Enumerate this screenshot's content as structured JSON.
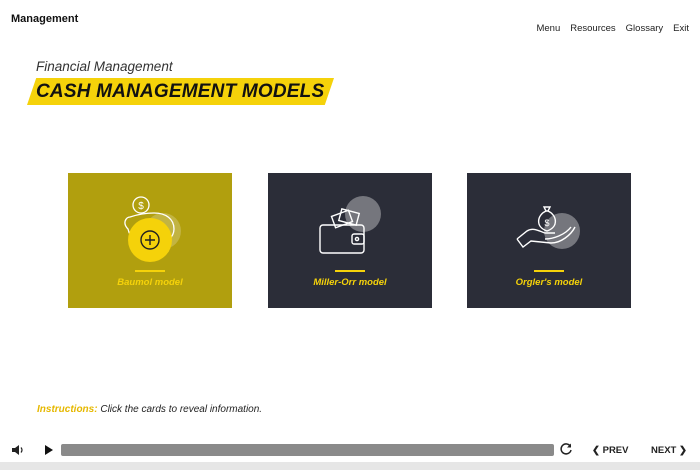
{
  "app": {
    "title": "Management"
  },
  "nav": {
    "menu": "Menu",
    "resources": "Resources",
    "glossary": "Glossary",
    "exit": "Exit"
  },
  "header": {
    "subtitle": "Financial Management",
    "title": "CASH MANAGEMENT MODELS"
  },
  "cards": [
    {
      "label": "Baumol model",
      "icon": "piggy-bank-coin-icon",
      "state": "hover"
    },
    {
      "label": "Miller-Orr model",
      "icon": "wallet-cash-icon"
    },
    {
      "label": "Orgler's model",
      "icon": "hand-money-bag-icon"
    }
  ],
  "instructions": {
    "lead": "Instructions:",
    "text": "Click the cards to reveal information."
  },
  "controls": {
    "prev": "PREV",
    "next": "NEXT",
    "progress": 0.0
  },
  "colors": {
    "accent": "#f5d20a",
    "card_active": "#b19f0e",
    "card_dark": "#2b2d38"
  }
}
